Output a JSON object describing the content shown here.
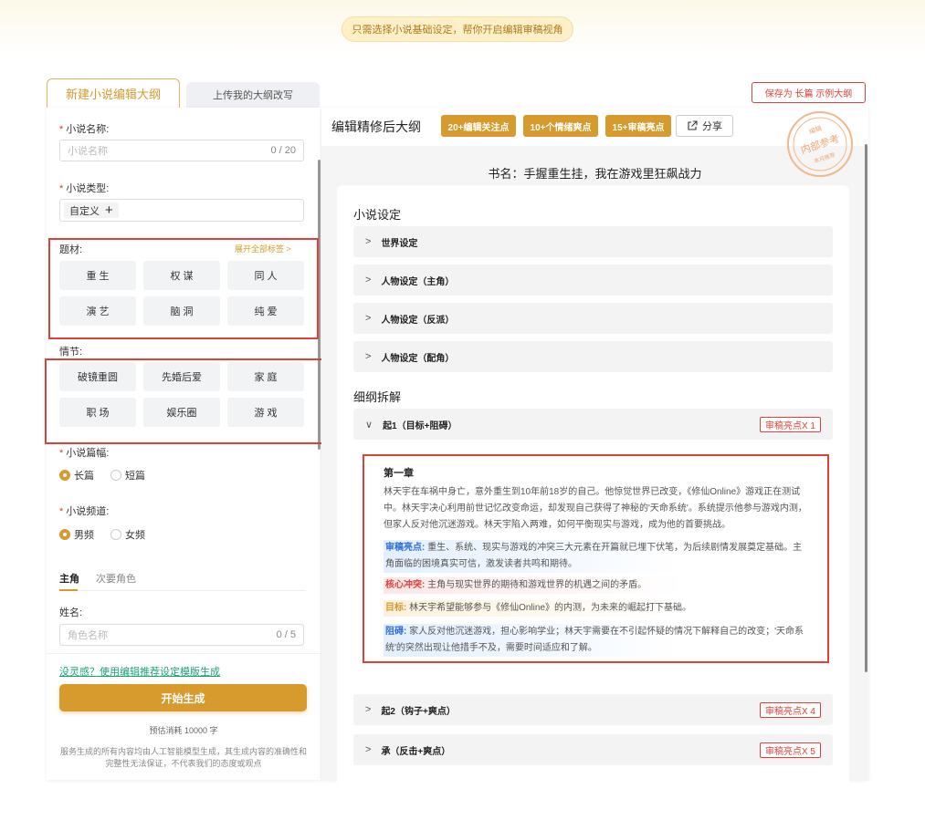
{
  "banner": "只需选择小说基础设定，帮你开启编辑审稿视角",
  "tabs": {
    "new": "新建小说编辑大纲",
    "upload": "上传我的大纲改写"
  },
  "form": {
    "name_label": "小说名称:",
    "name_placeholder": "小说名称",
    "name_count": "0 / 20",
    "type_label": "小说类型:",
    "type_chip": "自定义",
    "type_add": "+",
    "theme_label": "题材:",
    "expand_tags": "展开全部标签  >",
    "themes": [
      "重 生",
      "权 谋",
      "同 人",
      "演 艺",
      "脑 洞",
      "纯 爱"
    ],
    "plot_label": "情节:",
    "plots": [
      "破镜重圆",
      "先婚后爱",
      "家 庭",
      "职 场",
      "娱乐圈",
      "游 戏"
    ],
    "length_label": "小说篇幅:",
    "length_options": [
      "长篇",
      "短篇"
    ],
    "channel_label": "小说频道:",
    "channel_options": [
      "男频",
      "女频"
    ],
    "role_tabs": [
      "主角",
      "次要角色"
    ],
    "surname_label": "姓名:",
    "role_placeholder": "角色名称",
    "role_count": "0 / 5"
  },
  "bottom": {
    "inspire_link": "没灵感？使用编辑推荐设定模版生成",
    "generate_button": "开始生成",
    "cost": "预估消耗 10000 字",
    "disclaimer": "服务生成的所有内容均由人工智能模型生成，其生成内容的准确性和完整性无法保证，不代表我们的态度或观点"
  },
  "right": {
    "save_button": "保存为 长篇 示例大纲",
    "title": "编辑精修后大纲",
    "badges": [
      "20+编辑关注点",
      "10+个情绪爽点",
      "15+审稿亮点"
    ],
    "share": "分享",
    "stamp": {
      "top": "编辑",
      "middle": "内部参考",
      "bottom": "本月推荐"
    },
    "book_name": "书名：手握重生挂，我在游戏里狂飙战力",
    "setting_title": "小说设定",
    "settings": [
      "世界设定",
      "人物设定（主角）",
      "人物设定（反派）",
      "人物设定（配角）"
    ],
    "outline_title": "细纲拆解",
    "outline": [
      {
        "label": "起1（目标+阻碍）",
        "badge": "审稿亮点X 1",
        "chev": "∨"
      },
      {
        "label": "起2（钩子+爽点）",
        "badge": "审稿亮点X 4",
        "chev": ">"
      },
      {
        "label": "承（反击+爽点）",
        "badge": "审稿亮点X 5",
        "chev": ">"
      }
    ],
    "chapter": {
      "title": "第一章",
      "body": "林天宇在车祸中身亡，意外重生到10年前18岁的自己。他惊觉世界已改变，《修仙Online》游戏正在测试中。林天宇决心利用前世记忆改变命运，却发现自己获得了神秘的'天命系统'。系统提示他参与游戏内测，但家人反对他沉迷游戏。林天宇陷入两难，如何平衡现实与游戏，成为他的首要挑战。",
      "highlight_key": "审稿亮点:",
      "highlight": "重生、系统、现实与游戏的冲突三大元素在开篇就已埋下伏笔，为后续剧情发展奠定基础。主角面临的困境真实可信，激发读者共鸣和期待。",
      "conflict_key": "核心冲突:",
      "conflict": "主角与现实世界的期待和游戏世界的机遇之间的矛盾。",
      "goal_key": "目标:",
      "goal": "林天宇希望能够参与《修仙Online》的内测，为未来的崛起打下基础。",
      "obstacle_key": "阻碍:",
      "obstacle": "家人反对他沉迷游戏，担心影响学业；林天宇需要在不引起怀疑的情况下解释自己的改变；'天命系统'的突然出现让他措手不及，需要时间适应和了解。"
    }
  },
  "colors": {
    "accent": "#d69a2d",
    "alert": "#e0403a",
    "link": "#1aa37a",
    "blue": "#2f6fe0"
  }
}
